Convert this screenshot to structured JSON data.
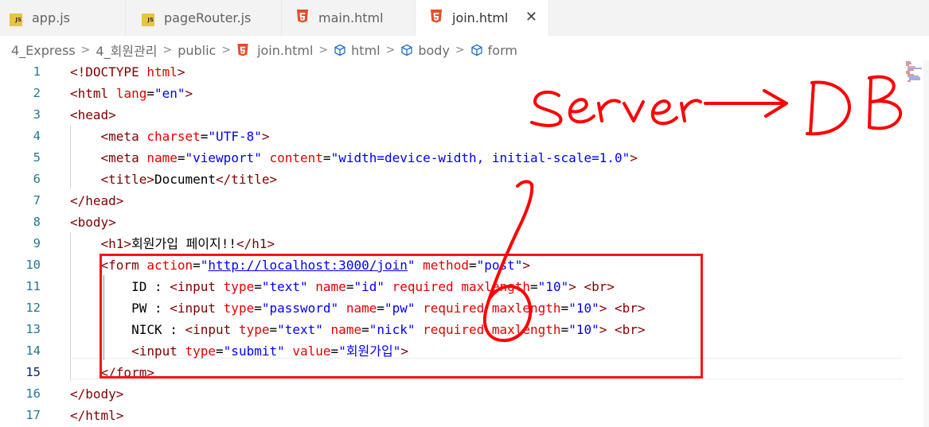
{
  "tabs": [
    {
      "label": "app.js",
      "type": "js"
    },
    {
      "label": "pageRouter.js",
      "type": "js"
    },
    {
      "label": "main.html",
      "type": "html"
    },
    {
      "label": "join.html",
      "type": "html",
      "active": true
    }
  ],
  "breadcrumb": [
    "4_Express",
    "4_회원관리",
    "public",
    "join.html",
    "html",
    "body",
    "form"
  ],
  "code": {
    "line_numbers": [
      "1",
      "2",
      "3",
      "4",
      "5",
      "6",
      "7",
      "8",
      "9",
      "10",
      "11",
      "12",
      "13",
      "14",
      "15",
      "16",
      "17"
    ],
    "current_line": "15"
  },
  "annotation": {
    "text_server": "Server",
    "text_db": "DB",
    "step_number": "6"
  },
  "colors": {
    "tag": "#800000",
    "attribute": "#e50000",
    "value": "#0000ff",
    "annotation": "#ff0000"
  }
}
